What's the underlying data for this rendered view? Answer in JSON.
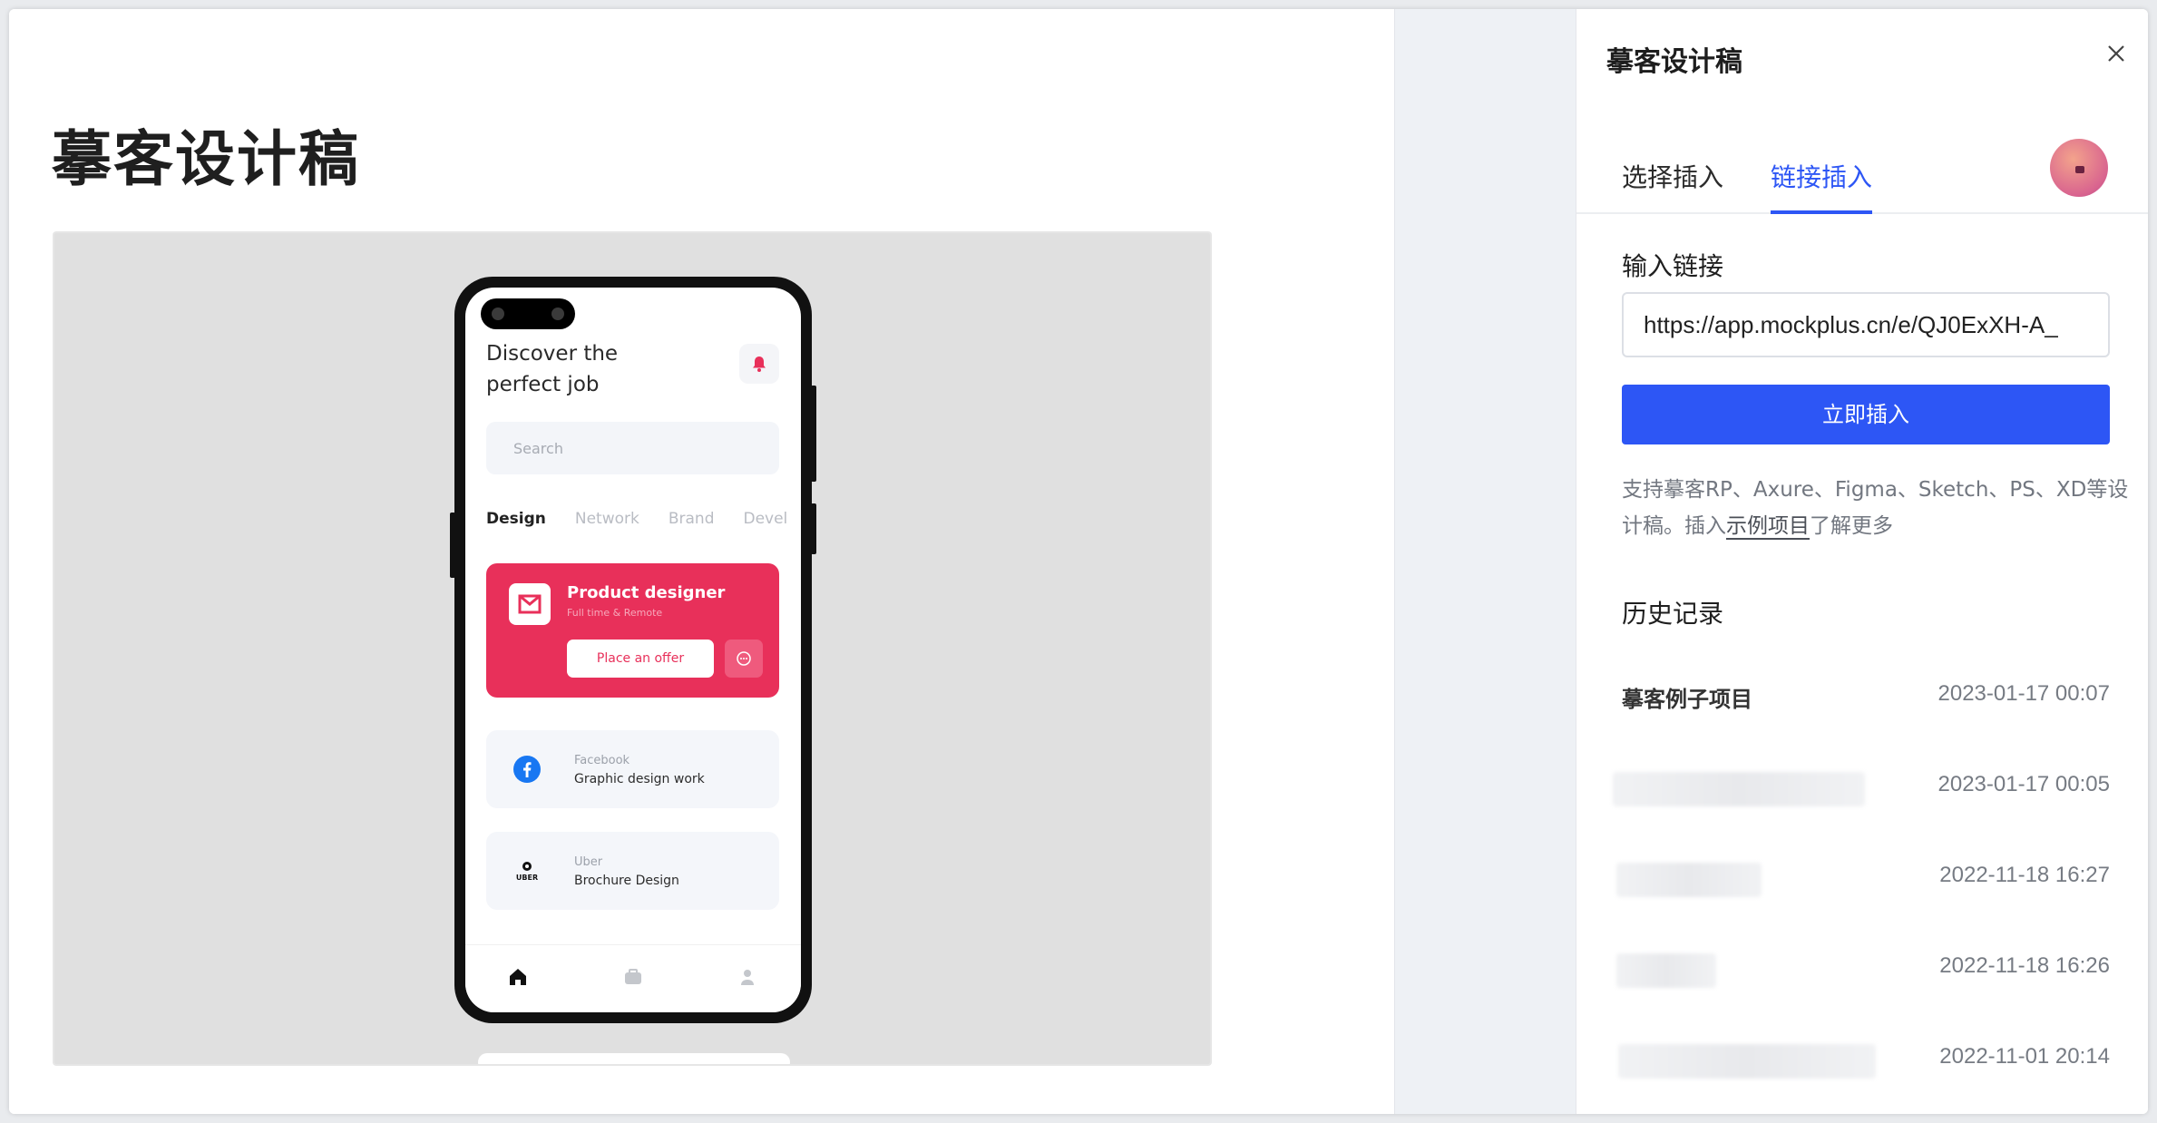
{
  "document": {
    "title": "摹客设计稿"
  },
  "phone_app": {
    "heading": "Discover the perfect job",
    "search_placeholder": "Search",
    "categories": [
      "Design",
      "Network",
      "Brand",
      "Devel"
    ],
    "featured": {
      "title": "Product designer",
      "subtitle": "Full time & Remote",
      "action": "Place an offer",
      "accent_color": "#e8305a"
    },
    "jobs": [
      {
        "company": "Facebook",
        "role": "Graphic design work",
        "icon": "facebook-icon"
      },
      {
        "company": "Uber",
        "role": "Brochure Design",
        "icon": "uber-icon"
      }
    ],
    "tab_icons": [
      "home-icon",
      "briefcase-icon",
      "profile-icon"
    ]
  },
  "panel": {
    "title": "摹客设计稿",
    "tabs": [
      {
        "label": "选择插入",
        "active": false
      },
      {
        "label": "链接插入",
        "active": true
      }
    ],
    "link_label": "输入链接",
    "link_value": "https://app.mockplus.cn/e/QJ0ExXH-A_",
    "insert_button": "立即插入",
    "hint_prefix": "支持摹客RP、Axure、Figma、Sketch、PS、XD等设计稿。插入",
    "hint_link": "示例项目",
    "hint_suffix": "了解更多",
    "history_label": "历史记录",
    "history": [
      {
        "name": "摹客例子项目",
        "date": "2023-01-17 00:07"
      },
      {
        "name": "",
        "date": "2023-01-17 00:05"
      },
      {
        "name": "",
        "date": "2022-11-18 16:27"
      },
      {
        "name": "",
        "date": "2022-11-18 16:26"
      },
      {
        "name": "",
        "date": "2022-11-01 20:14"
      }
    ],
    "accent_color": "#2d56f5"
  }
}
